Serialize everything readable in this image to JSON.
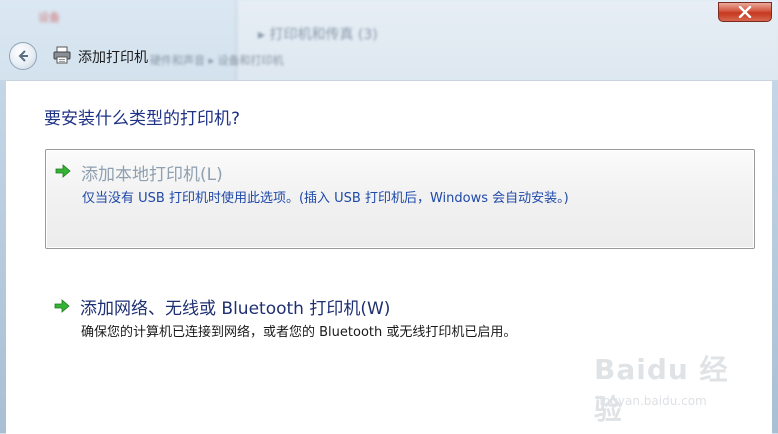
{
  "window": {
    "title": "添加打印机",
    "background_panel_title": "▸ 打印机和传真 (3)",
    "background_text": "设备",
    "background_path": "硬件和声音 ▸ 设备和打印机"
  },
  "dialog": {
    "question": "要安装什么类型的打印机?",
    "options": [
      {
        "title": "添加本地打印机(L)",
        "description": "仅当没有 USB 打印机时使用此选项。(插入 USB 打印机后，Windows 会自动安装。)"
      },
      {
        "title": "添加网络、无线或 Bluetooth 打印机(W)",
        "description": "确保您的计算机已连接到网络，或者您的 Bluetooth 或无线打印机已启用。"
      }
    ]
  },
  "watermark": {
    "text": "Baidu 经验",
    "sub": "jingyan.baidu.com"
  },
  "colors": {
    "accent_arrow": "#2fae2f",
    "question": "#1e3287",
    "link_blue": "#1f49a8"
  },
  "icons": [
    "close-icon",
    "back-arrow-icon",
    "printer-icon",
    "green-arrow-icon"
  ]
}
